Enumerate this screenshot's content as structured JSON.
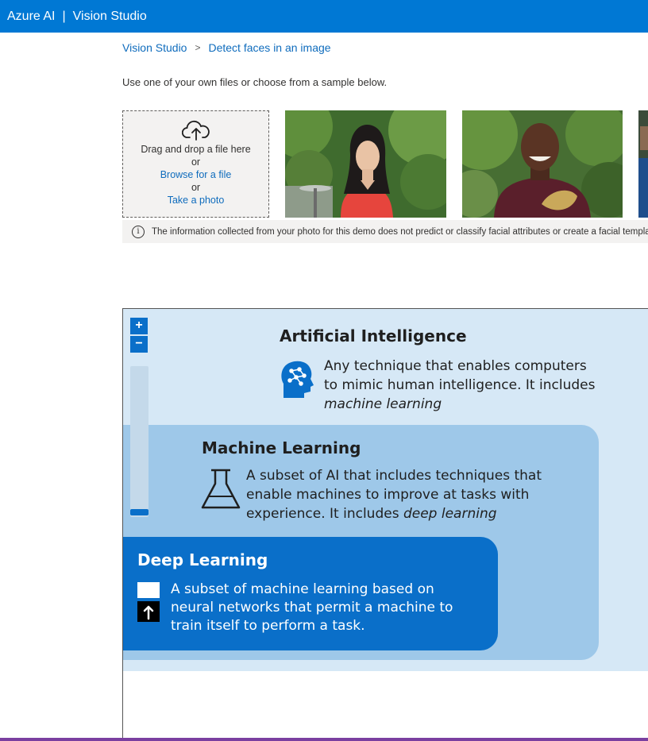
{
  "header": {
    "brand": "Azure AI",
    "separator": "|",
    "product": "Vision Studio"
  },
  "breadcrumb": {
    "root": "Vision Studio",
    "current": "Detect faces in an image",
    "separator": ">"
  },
  "intro_text": "Use one of your own files or choose from a sample below.",
  "upload": {
    "drag_text": "Drag and drop a file here",
    "or1": "or",
    "browse": "Browse for a file",
    "or2": "or",
    "take_photo": "Take a photo"
  },
  "notice": {
    "text": "The information collected from your photo for this demo does not predict or classify facial attributes or create a facial template."
  },
  "viewer": {
    "zoom_in": "+",
    "zoom_out": "−",
    "ai": {
      "title": "Artificial Intelligence",
      "line1": "Any technique that enables computers",
      "line2": "to mimic human intelligence. It includes",
      "line3": "machine learning"
    },
    "ml": {
      "title": "Machine Learning",
      "line1": "A subset of AI that includes techniques that",
      "line2": "enable machines to improve at tasks with",
      "line3_prefix": "experience. It includes ",
      "line3_em": "deep learning"
    },
    "dl": {
      "title": "Deep Learning",
      "line1": "A subset of machine learning based on",
      "line2": "neural networks that permit a machine to",
      "line3": "train itself to perform a task."
    }
  },
  "colors": {
    "accent": "#0078d4",
    "link": "#0f6cbd",
    "ai_layer": "#d6e8f6",
    "ml_layer": "#9ec8e9",
    "dl_layer": "#0a6fc9"
  },
  "icons": [
    "cloud-upload-icon",
    "info-icon",
    "ai-head-icon",
    "flask-icon",
    "deep-learning-icon"
  ]
}
